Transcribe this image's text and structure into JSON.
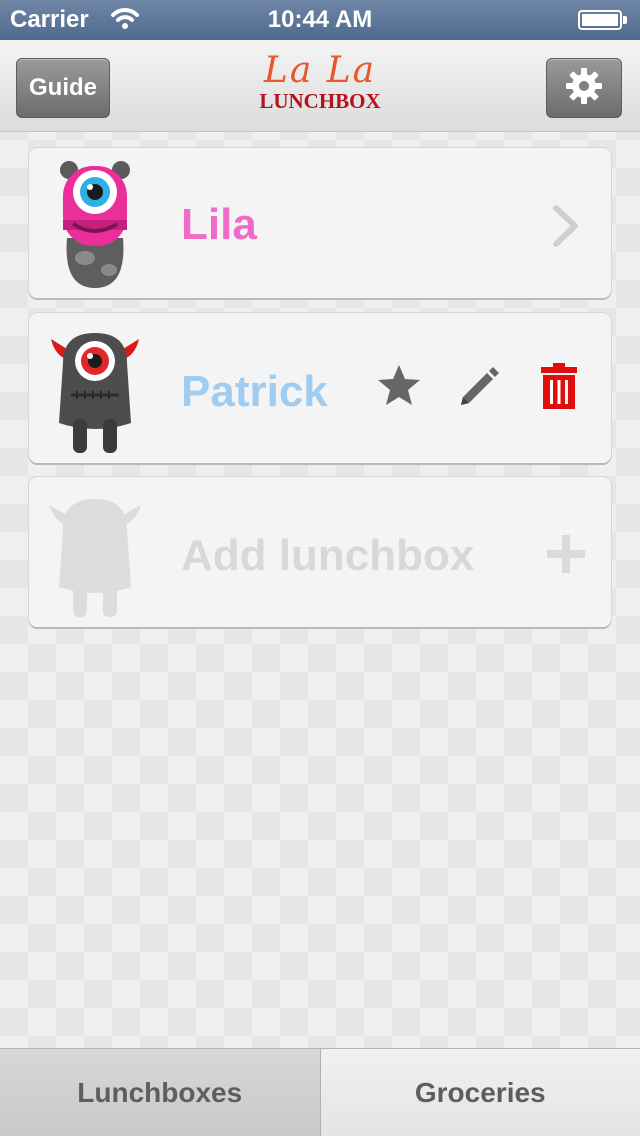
{
  "status_bar": {
    "carrier": "Carrier",
    "time": "10:44 AM",
    "wifi_icon": "wifi-icon",
    "battery_icon": "battery-icon"
  },
  "nav_bar": {
    "guide_label": "Guide",
    "logo_script": "La La",
    "logo_sub": "LUNCHBOX",
    "settings_icon": "gear-icon"
  },
  "lunchboxes": [
    {
      "name": "Lila",
      "name_color": "#f06bc7",
      "avatar": "pink-monster-avatar",
      "action_icon": "chevron-right-icon"
    },
    {
      "name": "Patrick",
      "name_color": "#9fcdf2",
      "avatar": "gray-horned-monster-avatar",
      "action_icons": [
        "star-icon",
        "pencil-icon",
        "trash-icon"
      ]
    }
  ],
  "add_lunchbox": {
    "label": "Add lunchbox",
    "icon": "plus-icon"
  },
  "tabs": [
    {
      "label": "Lunchboxes",
      "selected": true
    },
    {
      "label": "Groceries",
      "selected": false
    }
  ],
  "colors": {
    "status_bar": "#5d7699",
    "delete_red": "#e10e0e",
    "action_gray": "#666666"
  }
}
